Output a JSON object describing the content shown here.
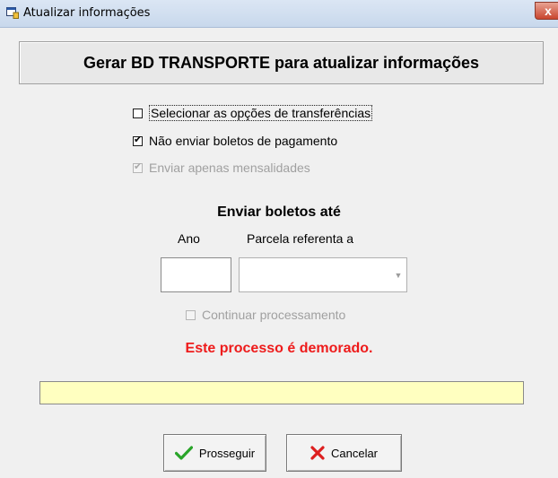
{
  "window": {
    "title": "Atualizar informações",
    "close_glyph": "x",
    "icon": "app-window-icon"
  },
  "header": {
    "title": "Gerar BD TRANSPORTE para atualizar informações"
  },
  "options": [
    {
      "label": "Selecionar as opções de transferências",
      "checked": false,
      "enabled": true
    },
    {
      "label": "Não enviar boletos de pagamento",
      "checked": true,
      "enabled": true
    },
    {
      "label": "Enviar apenas mensalidades",
      "checked": true,
      "enabled": false
    }
  ],
  "boletos": {
    "heading": "Enviar boletos até",
    "year_label": "Ano",
    "year_value": "",
    "parcel_label": "Parcela referenta a",
    "parcel_value": "",
    "continue_label": "Continuar processamento"
  },
  "warning": {
    "text": "Este processo é demorado.",
    "color": "#ee1b1b"
  },
  "progress": {
    "text": "",
    "bg": "#ffffc0"
  },
  "buttons": {
    "proceed_label": "Prosseguir",
    "cancel_label": "Cancelar"
  }
}
